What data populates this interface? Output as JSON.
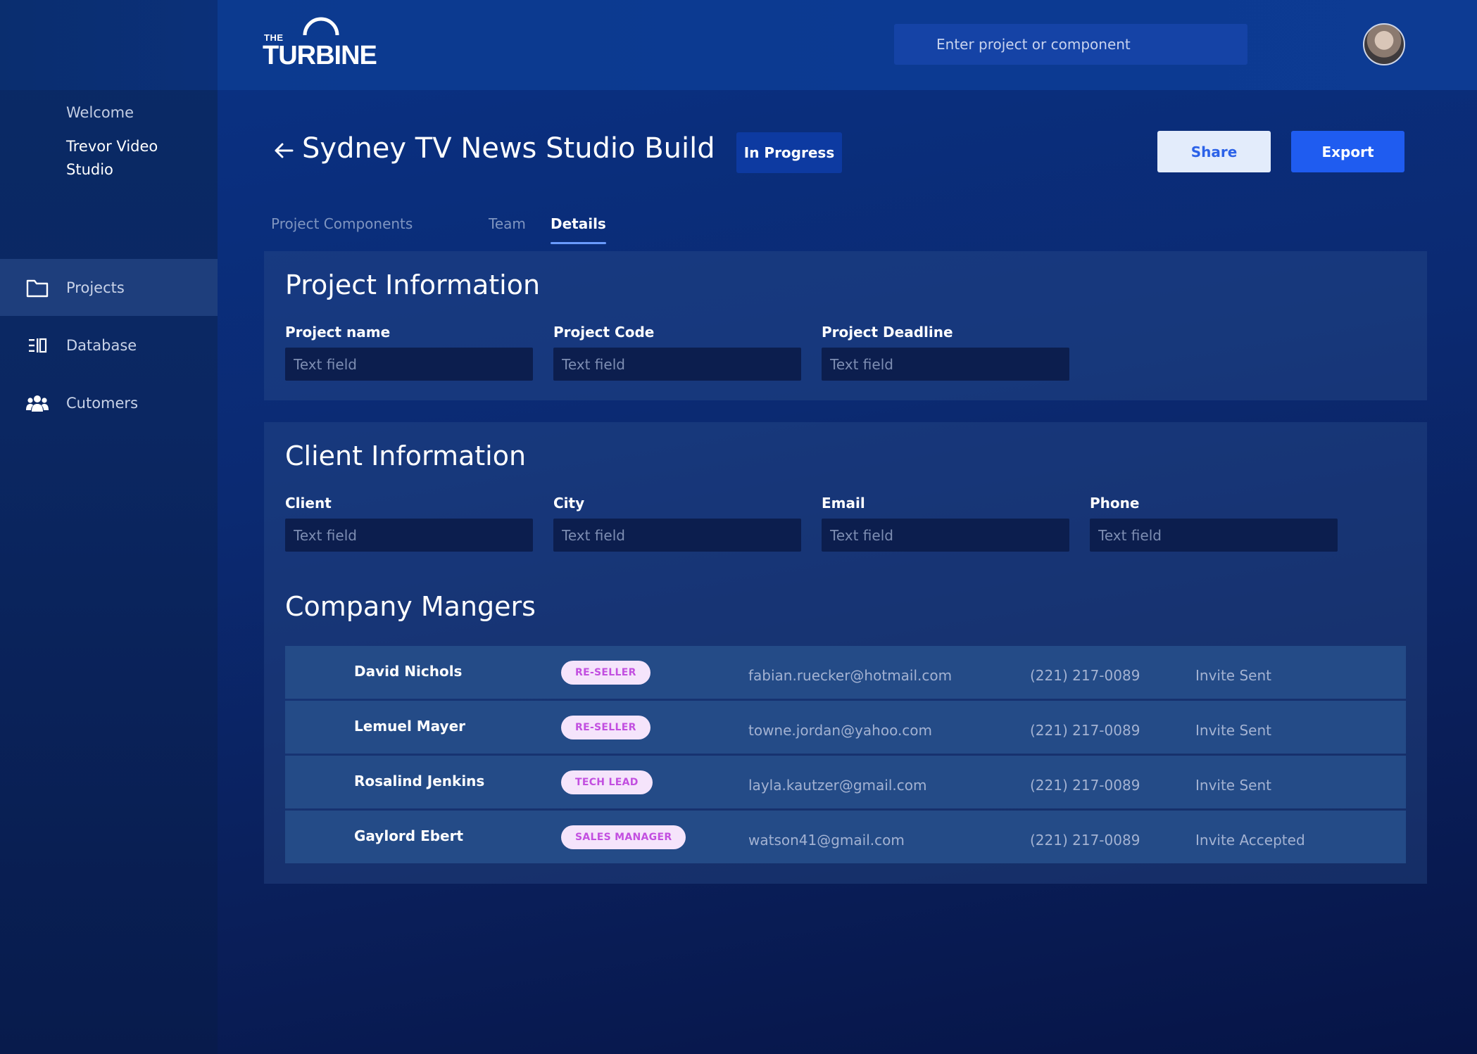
{
  "sidebar": {
    "welcome": "Welcome",
    "org_name": "Trevor Video Studio",
    "items": [
      {
        "label": "Projects",
        "icon": "folder-icon",
        "active": true
      },
      {
        "label": "Database",
        "icon": "database-icon",
        "active": false
      },
      {
        "label": "Cutomers",
        "icon": "users-icon",
        "active": false
      }
    ]
  },
  "header": {
    "logo_the": "THE",
    "logo_turbine": "TURBINE",
    "search_placeholder": "Enter project or component"
  },
  "page": {
    "title": "Sydney TV News Studio Build",
    "status": "In Progress",
    "share_label": "Share",
    "export_label": "Export",
    "tabs": [
      {
        "label": "Project Components",
        "active": false
      },
      {
        "label": "Team",
        "active": false
      },
      {
        "label": "Details",
        "active": true
      }
    ]
  },
  "project_info": {
    "title": "Project Information",
    "fields": [
      {
        "label": "Project name",
        "placeholder": "Text field"
      },
      {
        "label": "Project Code",
        "placeholder": "Text field"
      },
      {
        "label": "Project Deadline",
        "placeholder": "Text field"
      }
    ]
  },
  "client_info": {
    "title": "Client Information",
    "fields": [
      {
        "label": "Client",
        "placeholder": "Text field"
      },
      {
        "label": "City",
        "placeholder": "Text field"
      },
      {
        "label": "Email",
        "placeholder": "Text field"
      },
      {
        "label": "Phone",
        "placeholder": "Text field"
      }
    ]
  },
  "managers": {
    "title": "Company Mangers",
    "rows": [
      {
        "name": "David Nichols",
        "role": "RE-SELLER",
        "email": "fabian.ruecker@hotmail.com",
        "phone": "(221) 217-0089",
        "status": "Invite Sent"
      },
      {
        "name": "Lemuel Mayer",
        "role": "RE-SELLER",
        "email": "towne.jordan@yahoo.com",
        "phone": "(221) 217-0089",
        "status": "Invite Sent"
      },
      {
        "name": "Rosalind Jenkins",
        "role": "TECH LEAD",
        "email": "layla.kautzer@gmail.com",
        "phone": "(221) 217-0089",
        "status": "Invite Sent"
      },
      {
        "name": "Gaylord Ebert",
        "role": "SALES MANAGER",
        "email": "watson41@gmail.com",
        "phone": "(221) 217-0089",
        "status": "Invite Accepted"
      }
    ]
  },
  "colors": {
    "accent": "#1f5cf0",
    "badge_bg": "#f5e4fb",
    "badge_text": "#c24fe0"
  }
}
